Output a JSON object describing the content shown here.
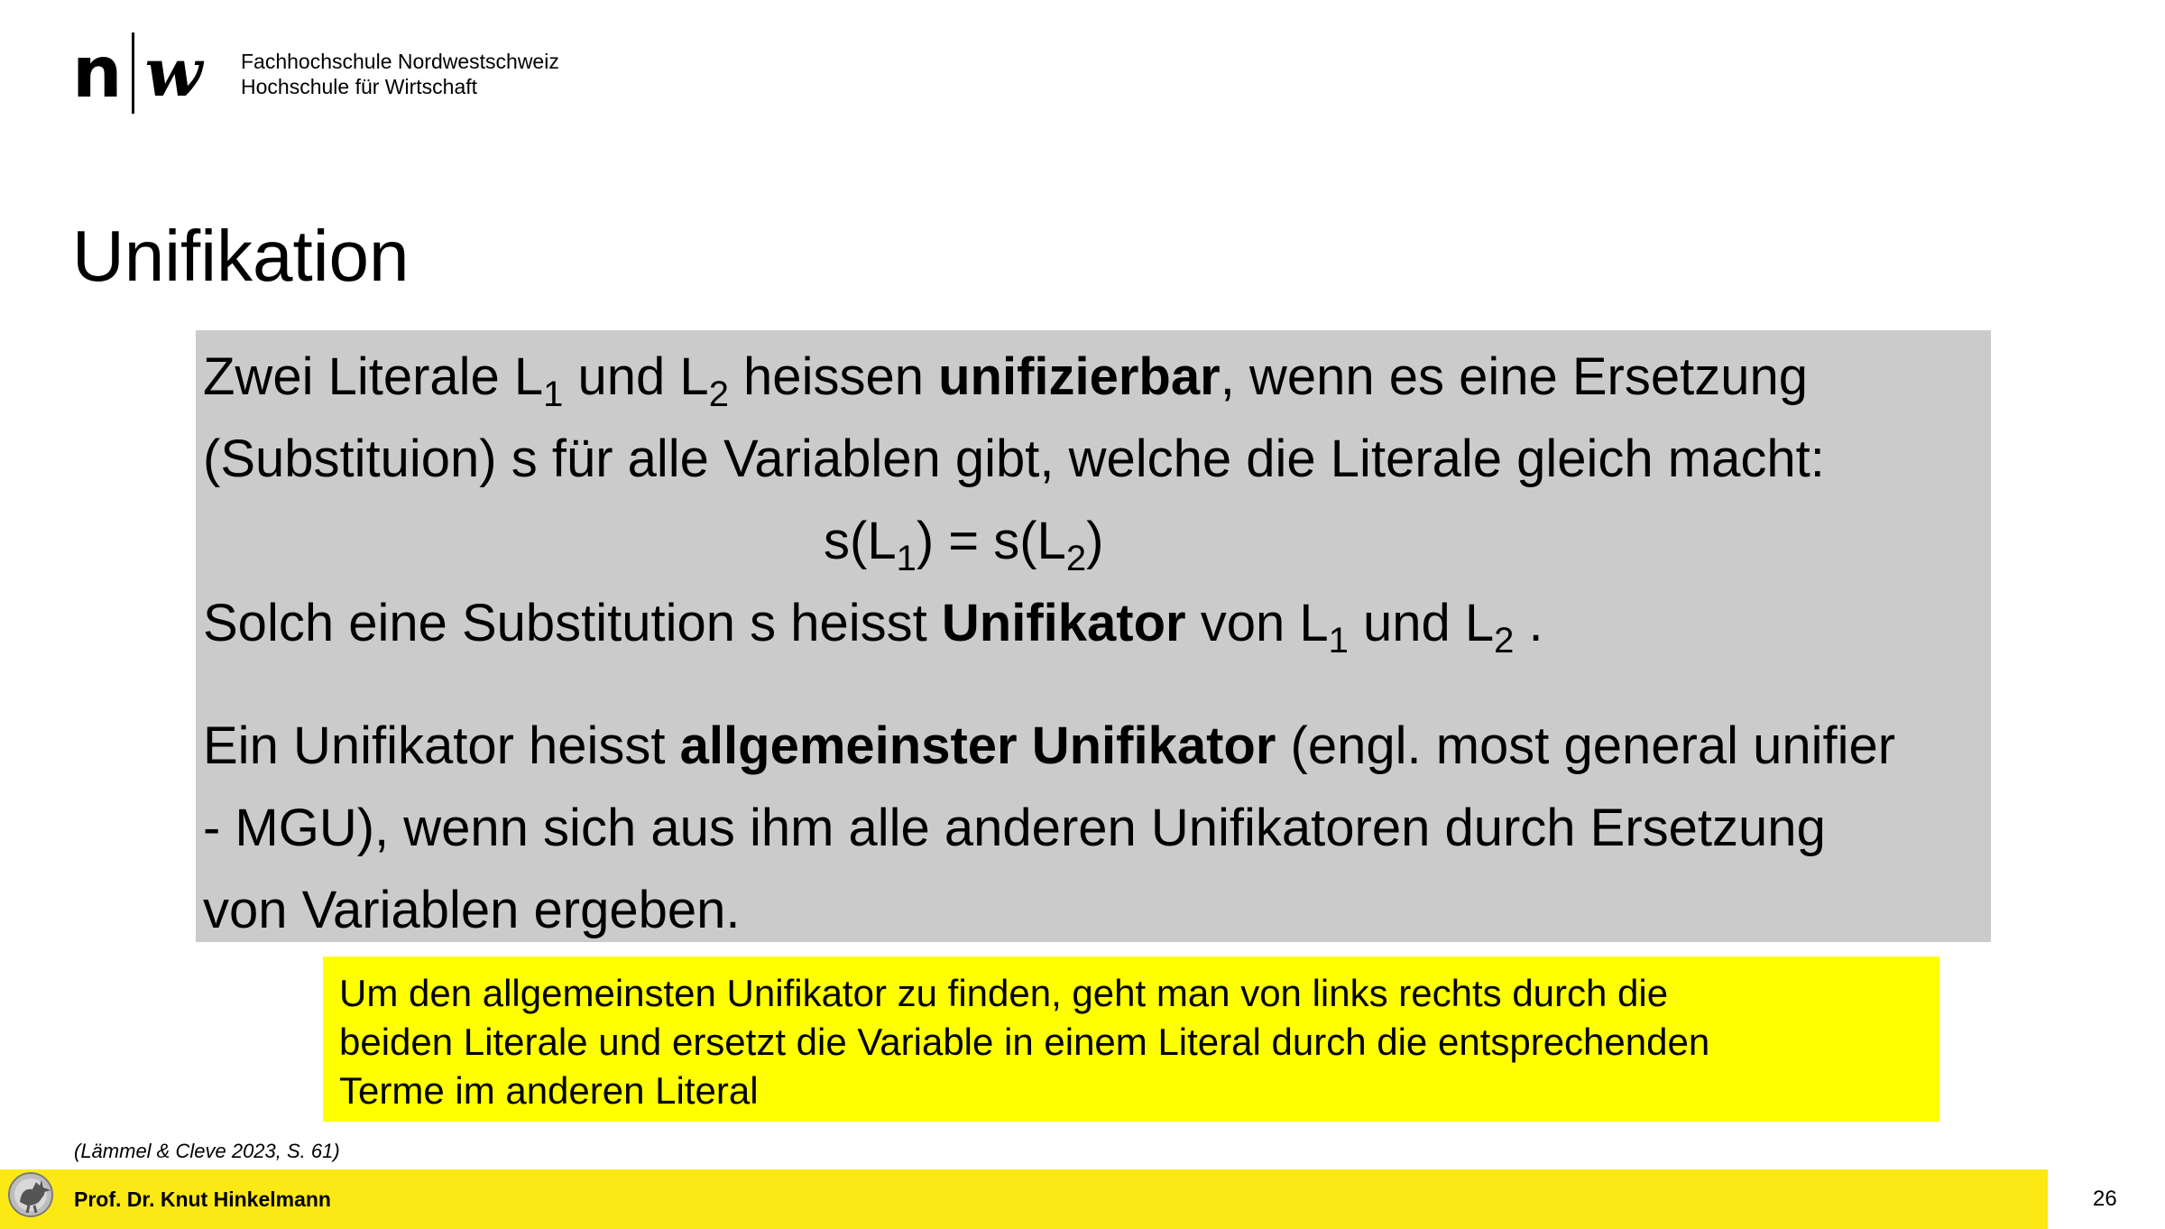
{
  "header": {
    "logo_n": "n",
    "logo_w": "w",
    "institution_line1": "Fachhochschule Nordwestschweiz",
    "institution_line2": "Hochschule für Wirtschaft"
  },
  "title": "Unifikation",
  "definition": {
    "p1_a": "Zwei Literale L",
    "p1_sub1": "1",
    "p1_b": " und L",
    "p1_sub2": "2",
    "p1_c": " heissen ",
    "p1_bold": "unifizierbar",
    "p1_d": ", wenn es eine Ersetzung",
    "p2": "(Substituion) s für alle Variablen gibt, welche die Literale gleich macht:",
    "formula_a": "s(L",
    "formula_sub1": "1",
    "formula_b": ") = s(L",
    "formula_sub2": "2",
    "formula_c": ")",
    "p4_a": "Solch eine Substitution s heisst ",
    "p4_bold": "Unifikator",
    "p4_b": " von L",
    "p4_sub1": "1",
    "p4_c": " und L",
    "p4_sub2": "2",
    "p4_d": " .",
    "p5_a": "Ein Unifikator heisst ",
    "p5_bold": "allgemeinster Unifikator",
    "p5_b": " (engl. most general unifier",
    "p6": "- MGU), wenn sich aus ihm alle anderen Unifikatoren durch Ersetzung",
    "p7": "von Variablen ergeben."
  },
  "note": "Um den allgemeinsten Unifikator zu finden, geht man  von links rechts durch die\nbeiden Literale und ersetzt die Variable in einem Literal durch die entsprechenden\nTerme im anderen Literal",
  "citation": "(Lämmel & Cleve 2023, S. 61)",
  "footer": {
    "author": "Prof. Dr. Knut Hinkelmann",
    "page_number": "26",
    "icon": "rooster-icon",
    "bar_color": "#fce814"
  },
  "colors": {
    "definition_box": "#cbcbcb",
    "note_box": "#ffff00"
  }
}
